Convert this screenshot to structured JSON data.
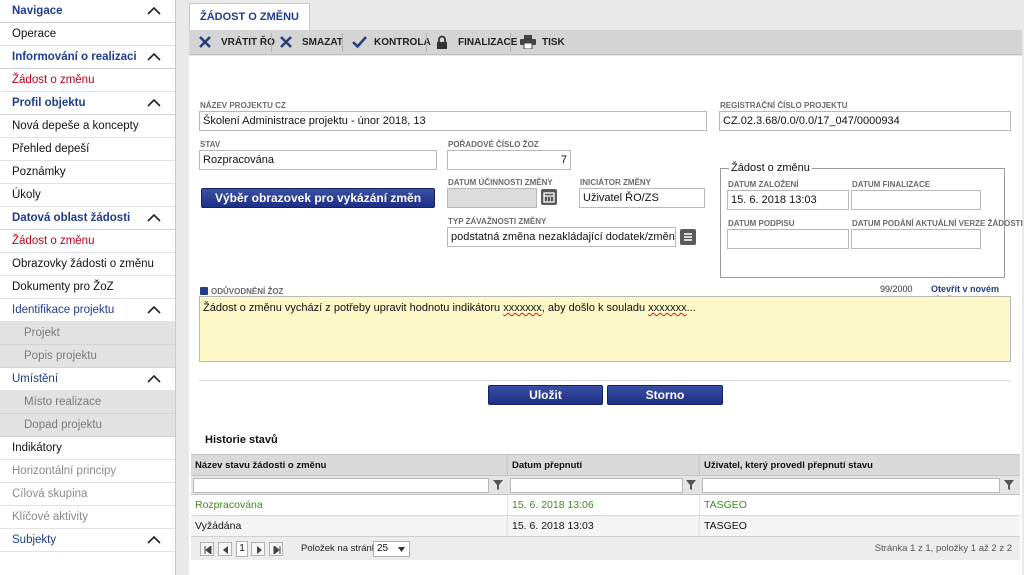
{
  "sidebar": {
    "items": [
      {
        "label": "Navigace",
        "kind": "head",
        "chevron": true
      },
      {
        "label": "Operace",
        "kind": "item"
      },
      {
        "label": "Informování o realizaci",
        "kind": "head",
        "chevron": true
      },
      {
        "label": "Žádost o změnu",
        "kind": "active"
      },
      {
        "label": "Profil objektu",
        "kind": "head",
        "chevron": true
      },
      {
        "label": "Nová depeše a koncepty",
        "kind": "item"
      },
      {
        "label": "Přehled depeší",
        "kind": "item"
      },
      {
        "label": "Poznámky",
        "kind": "item"
      },
      {
        "label": "Úkoly",
        "kind": "item"
      },
      {
        "label": "Datová oblast žádosti",
        "kind": "head",
        "chevron": true
      },
      {
        "label": "Žádost o změnu",
        "kind": "active"
      },
      {
        "label": "Obrazovky žádosti o změnu",
        "kind": "item"
      },
      {
        "label": "Dokumenty pro ŽoZ",
        "kind": "item"
      },
      {
        "label": "Identifikace projektu",
        "kind": "sub",
        "chevron": true
      },
      {
        "label": "Projekt",
        "kind": "grey"
      },
      {
        "label": "Popis projektu",
        "kind": "grey"
      },
      {
        "label": "Umístění",
        "kind": "sub",
        "chevron": true
      },
      {
        "label": "Místo realizace",
        "kind": "grey"
      },
      {
        "label": "Dopad projektu",
        "kind": "grey"
      },
      {
        "label": "Indikátory",
        "kind": "item"
      },
      {
        "label": "Horizontální principy",
        "kind": "dis"
      },
      {
        "label": "Cílová skupina",
        "kind": "dis"
      },
      {
        "label": "Klíčové aktivity",
        "kind": "dis"
      },
      {
        "label": "Subjekty",
        "kind": "sub",
        "chevron": true
      }
    ]
  },
  "tab": {
    "label": "ŽÁDOST O ZMĚNU"
  },
  "toolbar": {
    "vratit": "VRÁTIT ŘO",
    "smazat": "SMAZAT",
    "kontrola": "KONTROLA",
    "finalizace": "FINALIZACE",
    "tisk": "TISK"
  },
  "form": {
    "nazev_label": "NÁZEV PROJEKTU CZ",
    "nazev_value": "Školení Administrace projektu - únor 2018, 13",
    "reg_label": "REGISTRAČNÍ ČÍSLO PROJEKTU",
    "reg_value": "CZ.02.3.68/0.0/0.0/17_047/0000934",
    "stav_label": "STAV",
    "stav_value": "Rozpracována",
    "poradove_label": "POŘADOVÉ ČÍSLO ŽOZ",
    "poradove_value": "7",
    "vyber_button": "Výběr obrazovek pro vykázání změn",
    "ucinnost_label": "DATUM ÚČINNOSTI ZMĚNY",
    "ucinnost_value": "",
    "iniciator_label": "INICIÁTOR ZMĚNY",
    "iniciator_value": "Uživatel ŘO/ZS",
    "typ_label": "TYP ZÁVAŽNOSTI ZMĚNY",
    "typ_value": "podstatná změna nezakládající dodatek/změnu p...",
    "zoz_legend": "Žádost o změnu",
    "zalozeni_label": "DATUM ZALOŽENÍ",
    "zalozeni_value": "15. 6. 2018 13:03",
    "finalizace_label": "DATUM FINALIZACE",
    "finalizace_value": "",
    "podpisu_label": "DATUM PODPISU",
    "podpisu_value": "",
    "podani_label": "DATUM PODÁNÍ AKTUÁLNÍ VERZE ŽÁDOSTI",
    "podani_value": "",
    "oduvodneni_label": "ODŮVODNĚNÍ ŽOZ",
    "oduvodneni_counter": "99/2000",
    "oduvodneni_link": "Otevřít v novém okně",
    "oduvodneni_text_a": "Žádost o změnu vychází z potřeby upravit hodnotu indikátoru ",
    "oduvodneni_text_b": "xxxxxxx",
    "oduvodneni_text_c": ", aby došlo k souladu ",
    "oduvodneni_text_d": "xxxxxxx",
    "oduvodneni_text_e": "..."
  },
  "actions": {
    "ulozit": "Uložit",
    "storno": "Storno"
  },
  "history": {
    "title": "Historie stavů",
    "columns": [
      "Název stavu žádosti o změnu",
      "Datum přepnutí",
      "Uživatel, který provedl přepnutí stavu"
    ],
    "rows": [
      {
        "stav": "Rozpracována",
        "datum": "15. 6. 2018 13:06",
        "uzivatel": "TASGEO"
      },
      {
        "stav": "Vyžádána",
        "datum": "15. 6. 2018 13:03",
        "uzivatel": "TASGEO"
      }
    ]
  },
  "pager": {
    "current_page": "1",
    "per_page_label": "Položek na stránku",
    "per_page_value": "25",
    "summary": "Stránka 1 z 1, položky 1 až 2 z 2"
  },
  "colors": {
    "brand_blue": "#1f3d8e",
    "active_red": "#c0001a",
    "row_selected_green": "#3d8a23",
    "note_yellow": "#fdf8c8"
  }
}
